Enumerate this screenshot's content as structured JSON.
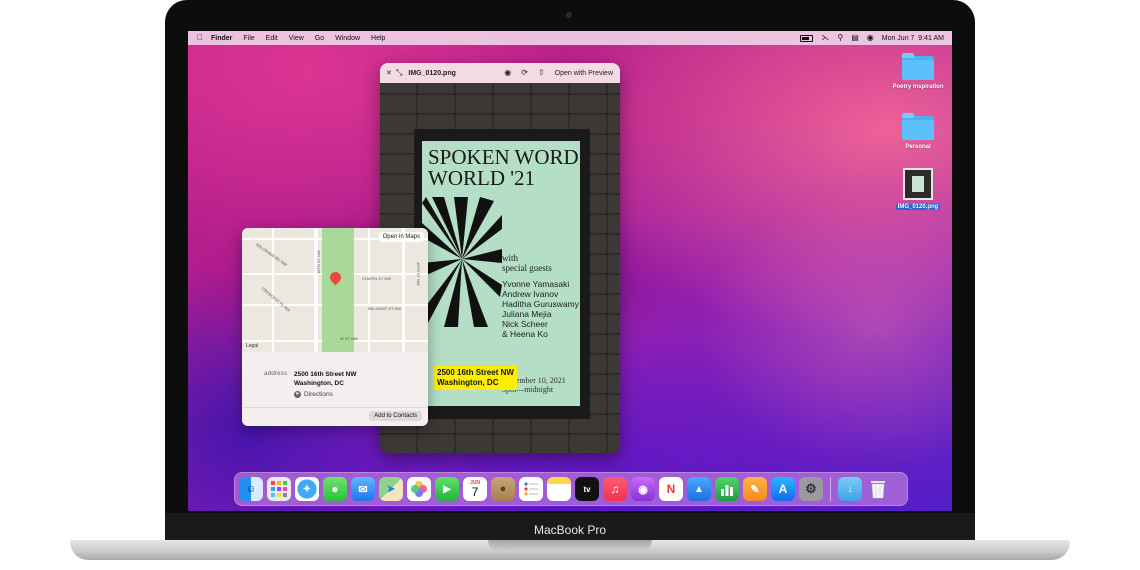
{
  "device": {
    "model_label": "MacBook Pro"
  },
  "menubar": {
    "app_name": "Finder",
    "items": [
      "File",
      "Edit",
      "View",
      "Go",
      "Window",
      "Help"
    ],
    "clock": "Mon Jun 7  9:41 AM"
  },
  "desktop": {
    "items": [
      {
        "label": "Poetry Inspiration",
        "type": "folder"
      },
      {
        "label": "Personal",
        "type": "folder"
      },
      {
        "label": "IMG_0120.png",
        "type": "image",
        "selected": true
      }
    ]
  },
  "quicklook": {
    "title": "IMG_0120.png",
    "open_with": "Open with Preview",
    "poster": {
      "title_line1": "SPOKEN WORD",
      "title_line2": "WORLD '21",
      "with_line1": "with",
      "with_line2": "special guests",
      "guests": [
        "Yvonne Yamasaki",
        "Andrew Ivanov",
        "Haditha Guruswamy",
        "Juliana Mejia",
        "Nick Scheer",
        "& Heena Ko"
      ],
      "date_line1": "November 10, 2021",
      "date_line2": "5pm—midnight"
    },
    "live_text_line1": "2500 16th Street NW",
    "live_text_line2": "Washington, DC"
  },
  "maps_card": {
    "open_maps": "Open in Maps",
    "legal": "Legal",
    "address_label": "address",
    "address_line1": "2500 16th Street NW",
    "address_line2": "Washington, DC",
    "directions": "Directions",
    "add_to_contacts": "Add to Contacts",
    "road_labels": [
      "16TH ST NW",
      "KALORAMA RD NW",
      "CHAPIN ST NW",
      "CRESCENT PL NW",
      "BELMONT ST NW",
      "W ST NW",
      "15TH ST NW"
    ]
  },
  "dock": {
    "calendar_month": "JUN",
    "calendar_day": "7",
    "apps": [
      "Finder",
      "Launchpad",
      "Safari",
      "Messages",
      "Mail",
      "Maps",
      "Photos",
      "FaceTime",
      "Calendar",
      "Contacts",
      "Reminders",
      "Notes",
      "TV",
      "Music",
      "Podcasts",
      "News",
      "Keynote",
      "Numbers",
      "Pages",
      "App Store",
      "System Preferences",
      "Downloads",
      "Trash"
    ],
    "tv_label": "tv"
  },
  "colors": {
    "live_text_highlight": "#ffee00",
    "poster_bg": "#b4dec6",
    "selection_blue": "#2a6ce0"
  }
}
